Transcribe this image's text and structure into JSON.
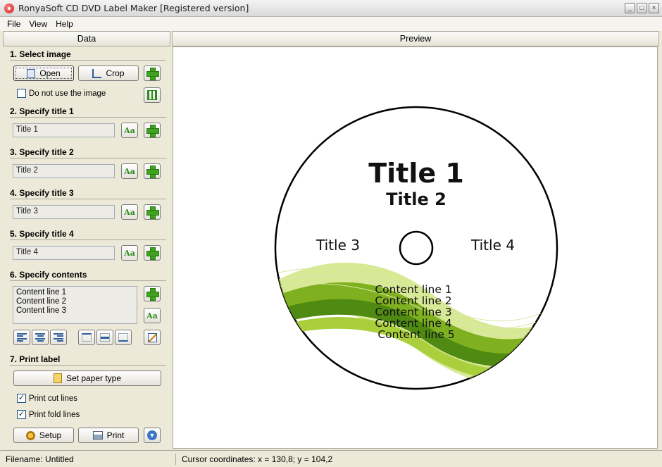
{
  "window": {
    "title": "RonyaSoft CD DVD Label Maker [Registered version]"
  },
  "menu": [
    "File",
    "View",
    "Help"
  ],
  "panels": {
    "data": "Data",
    "preview": "Preview"
  },
  "sections": {
    "select_image": "1. Select image",
    "title1": "2. Specify title 1",
    "title2": "3. Specify title 2",
    "title3": "4. Specify title 3",
    "title4": "5. Specify title 4",
    "contents": "6. Specify contents",
    "print": "7. Print label"
  },
  "buttons": {
    "open": "Open",
    "crop": "Crop",
    "paper": "Set paper type",
    "setup": "Setup",
    "print": "Print"
  },
  "checks": {
    "no_image": "Do not use the image",
    "cut_lines": "Print cut lines",
    "fold_lines": "Print fold lines",
    "cut_checked": "✓",
    "fold_checked": "✓"
  },
  "fields": {
    "title1": "Title 1",
    "title2": "Title 2",
    "title3": "Title 3",
    "title4": "Title 4"
  },
  "content_lines": [
    "Content line 1",
    "Content line 2",
    "Content line 3"
  ],
  "disc": {
    "title1": "Title 1",
    "title2": "Title 2",
    "title3": "Title 3",
    "title4": "Title 4",
    "lines": [
      "Content line 1",
      "Content line 2",
      "Content line 3",
      "Content line 4",
      "Content line 5"
    ]
  },
  "status": {
    "filename": "Filename: Untitled",
    "cursor": "Cursor coordinates: x = 130,8; y = 104,2"
  },
  "colors": {
    "accent_green": "#3fa31f",
    "swoosh_dark": "#7fb01f",
    "swoosh_light": "#c7df6a"
  }
}
